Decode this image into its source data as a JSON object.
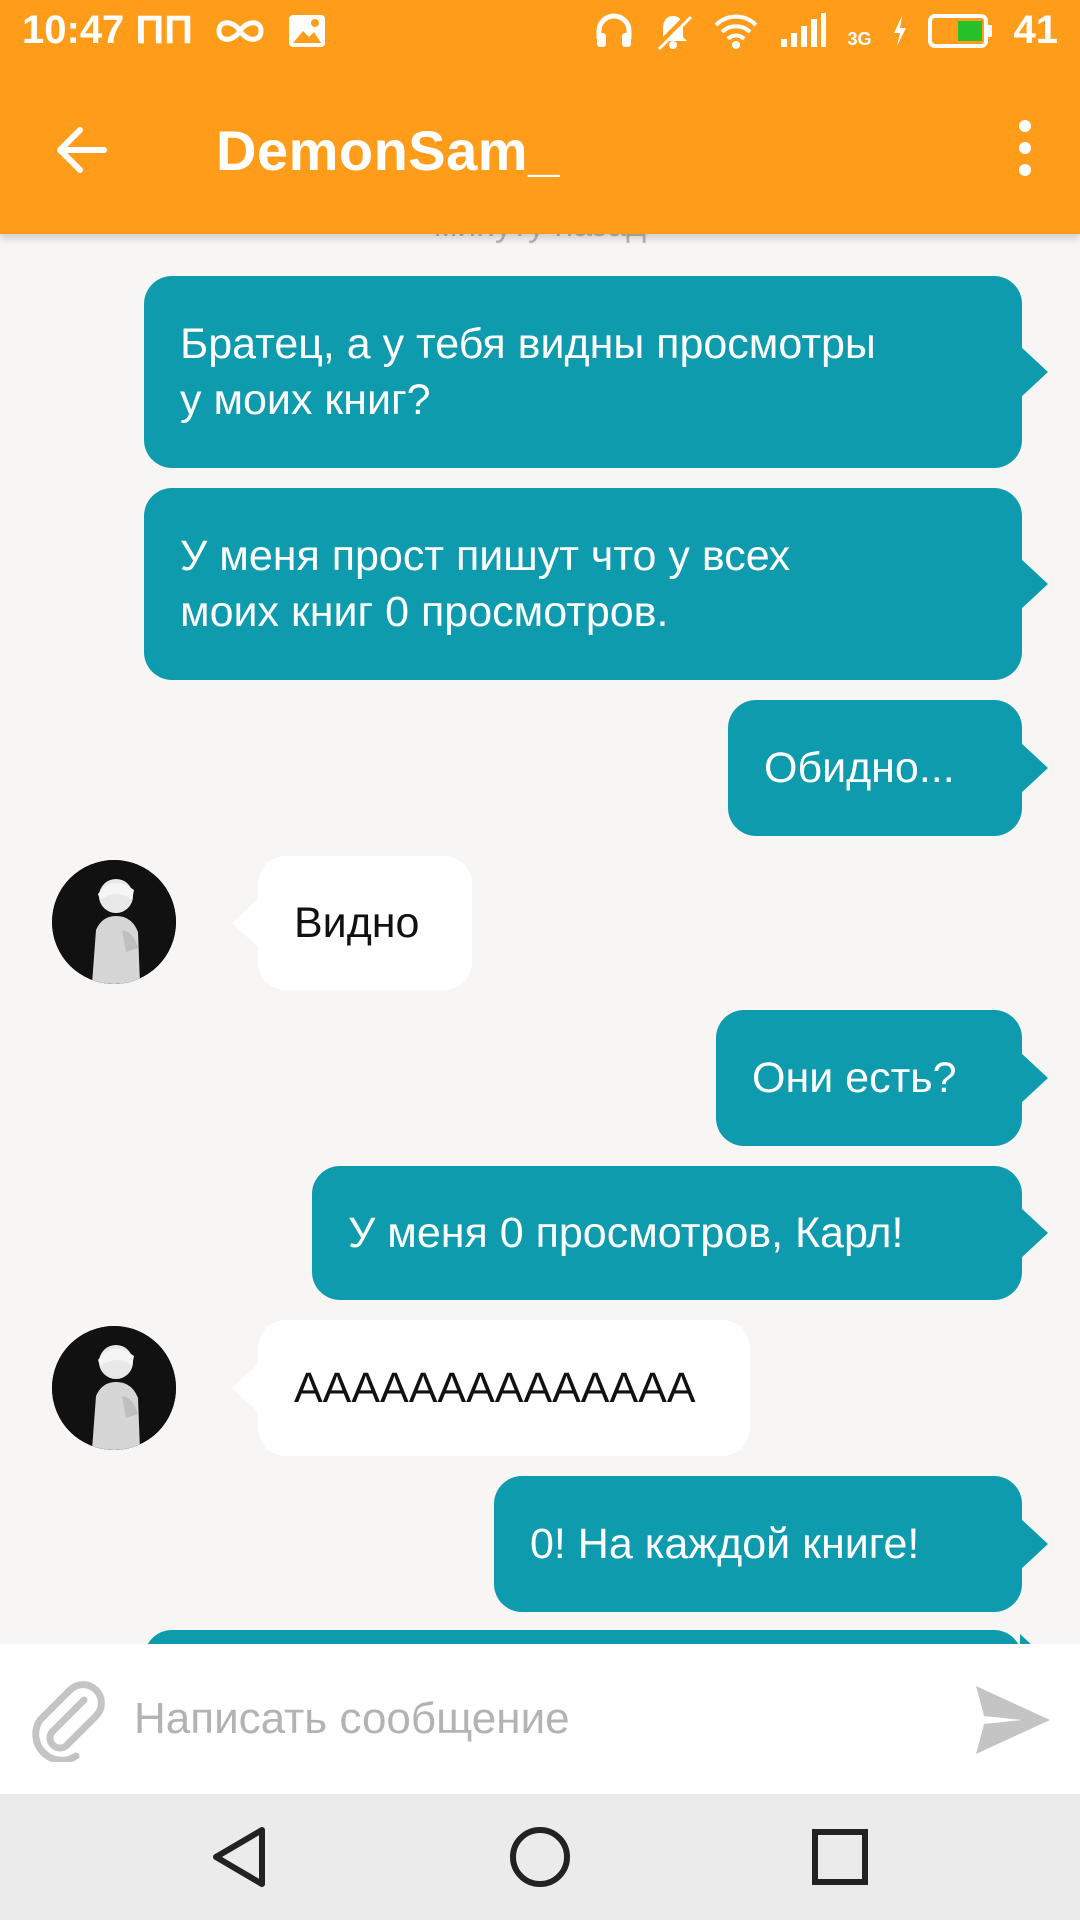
{
  "status_bar": {
    "time": "10:47 ПП",
    "battery_level": "41",
    "network_type": "3G"
  },
  "header": {
    "title": "DemonSam_"
  },
  "timestamp_partial": "минуту назад",
  "messages": [
    {
      "direction": "out",
      "text_lines": [
        "Братец, а у тебя видны просмотры",
        "у моих книг?"
      ]
    },
    {
      "direction": "out",
      "text_lines": [
        "У меня прост пишут что у всех",
        "моих книг 0 просмотров."
      ]
    },
    {
      "direction": "out",
      "text_lines": [
        "Обидно..."
      ]
    },
    {
      "direction": "in",
      "text_lines": [
        "Видно"
      ]
    },
    {
      "direction": "out",
      "text_lines": [
        "Они есть?"
      ]
    },
    {
      "direction": "out",
      "text_lines": [
        "У меня 0 просмотров, Карл!"
      ]
    },
    {
      "direction": "in",
      "text_lines": [
        "АААААААААААААА"
      ]
    },
    {
      "direction": "out",
      "text_lines": [
        "0! На каждой книге!"
      ]
    }
  ],
  "composer": {
    "placeholder": "Написать сообщение"
  },
  "colors": {
    "accent": "#ff9c1a",
    "outgoing_bubble": "#0f9bae",
    "incoming_bubble": "#ffffff",
    "background": "#f8f6f4"
  }
}
